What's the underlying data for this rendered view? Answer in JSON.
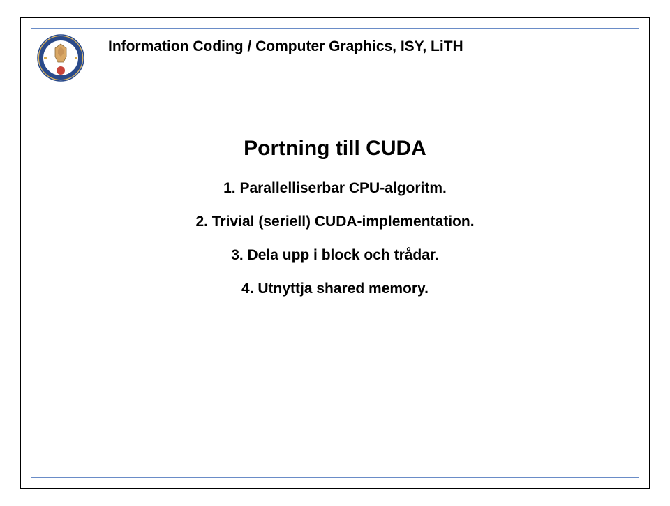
{
  "header": {
    "title": "Information Coding / Computer Graphics, ISY, LiTH"
  },
  "slide": {
    "title": "Portning till CUDA",
    "items": [
      "1. Parallelliserbar CPU-algoritm.",
      "2. Trivial (seriell) CUDA-implementation.",
      "3. Dela upp i block och trådar.",
      "4. Utnyttja shared memory."
    ]
  }
}
